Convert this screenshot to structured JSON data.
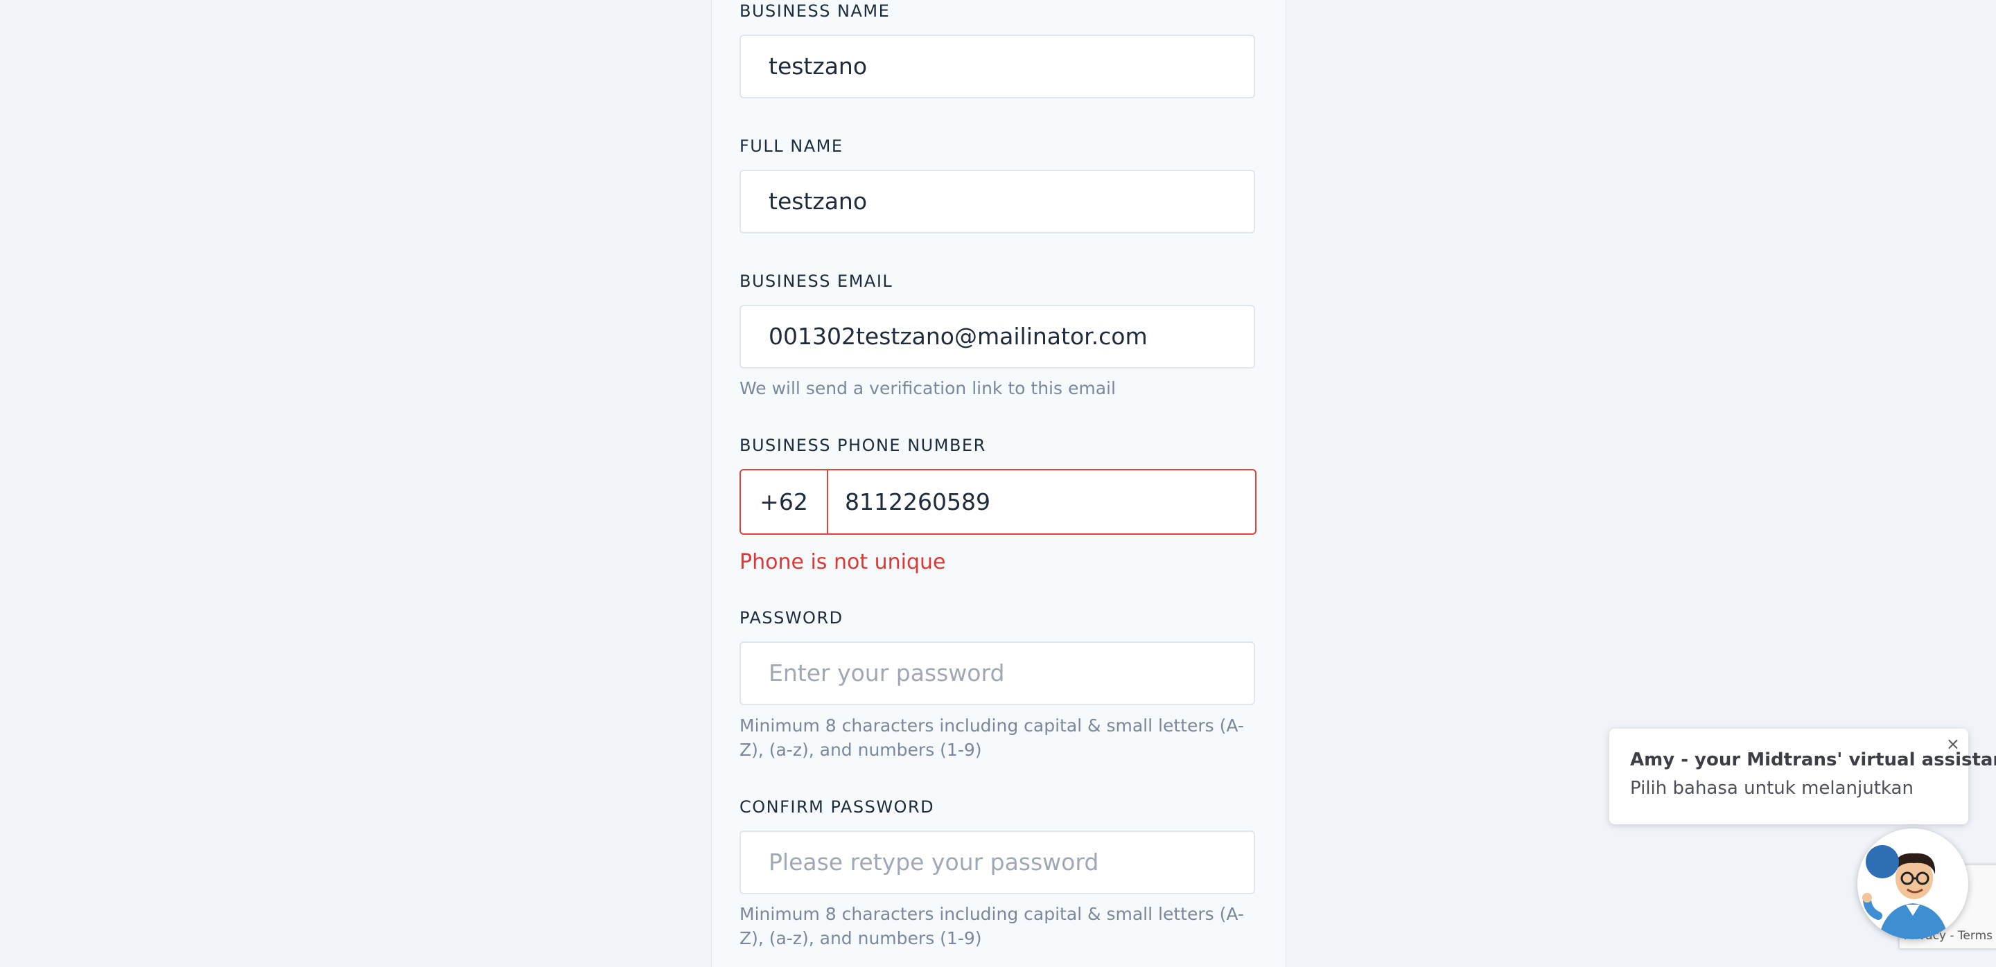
{
  "form": {
    "business_name": {
      "label": "BUSINESS NAME",
      "value": "testzano"
    },
    "full_name": {
      "label": "FULL NAME",
      "value": "testzano"
    },
    "business_email": {
      "label": "BUSINESS EMAIL",
      "value": "001302testzano@mailinator.com",
      "help": "We will send a verification link to this email"
    },
    "business_phone": {
      "label": "BUSINESS PHONE NUMBER",
      "prefix": "+62",
      "value": "8112260589",
      "error": "Phone is not unique"
    },
    "password": {
      "label": "PASSWORD",
      "placeholder": "Enter your password",
      "help": "Minimum 8 characters including capital & small letters (A-Z), (a-z), and numbers (1-9)"
    },
    "confirm_password": {
      "label": "CONFIRM PASSWORD",
      "placeholder": "Please retype your password",
      "help": "Minimum 8 characters including capital & small letters (A-Z), (a-z), and numbers (1-9)"
    }
  },
  "chat": {
    "title": "Amy - your Midtrans' virtual assistant",
    "subtitle": "Pilih bahasa untuk melanjutkan",
    "close_glyph": "×",
    "avatar_icon": "assistant-avatar-icon"
  },
  "recaptcha": {
    "text": "Privacy - Terms"
  },
  "colors": {
    "error": "#d93a34",
    "label": "#1d2b3a",
    "help": "#7b879a",
    "placeholder": "#a0a8b5"
  }
}
